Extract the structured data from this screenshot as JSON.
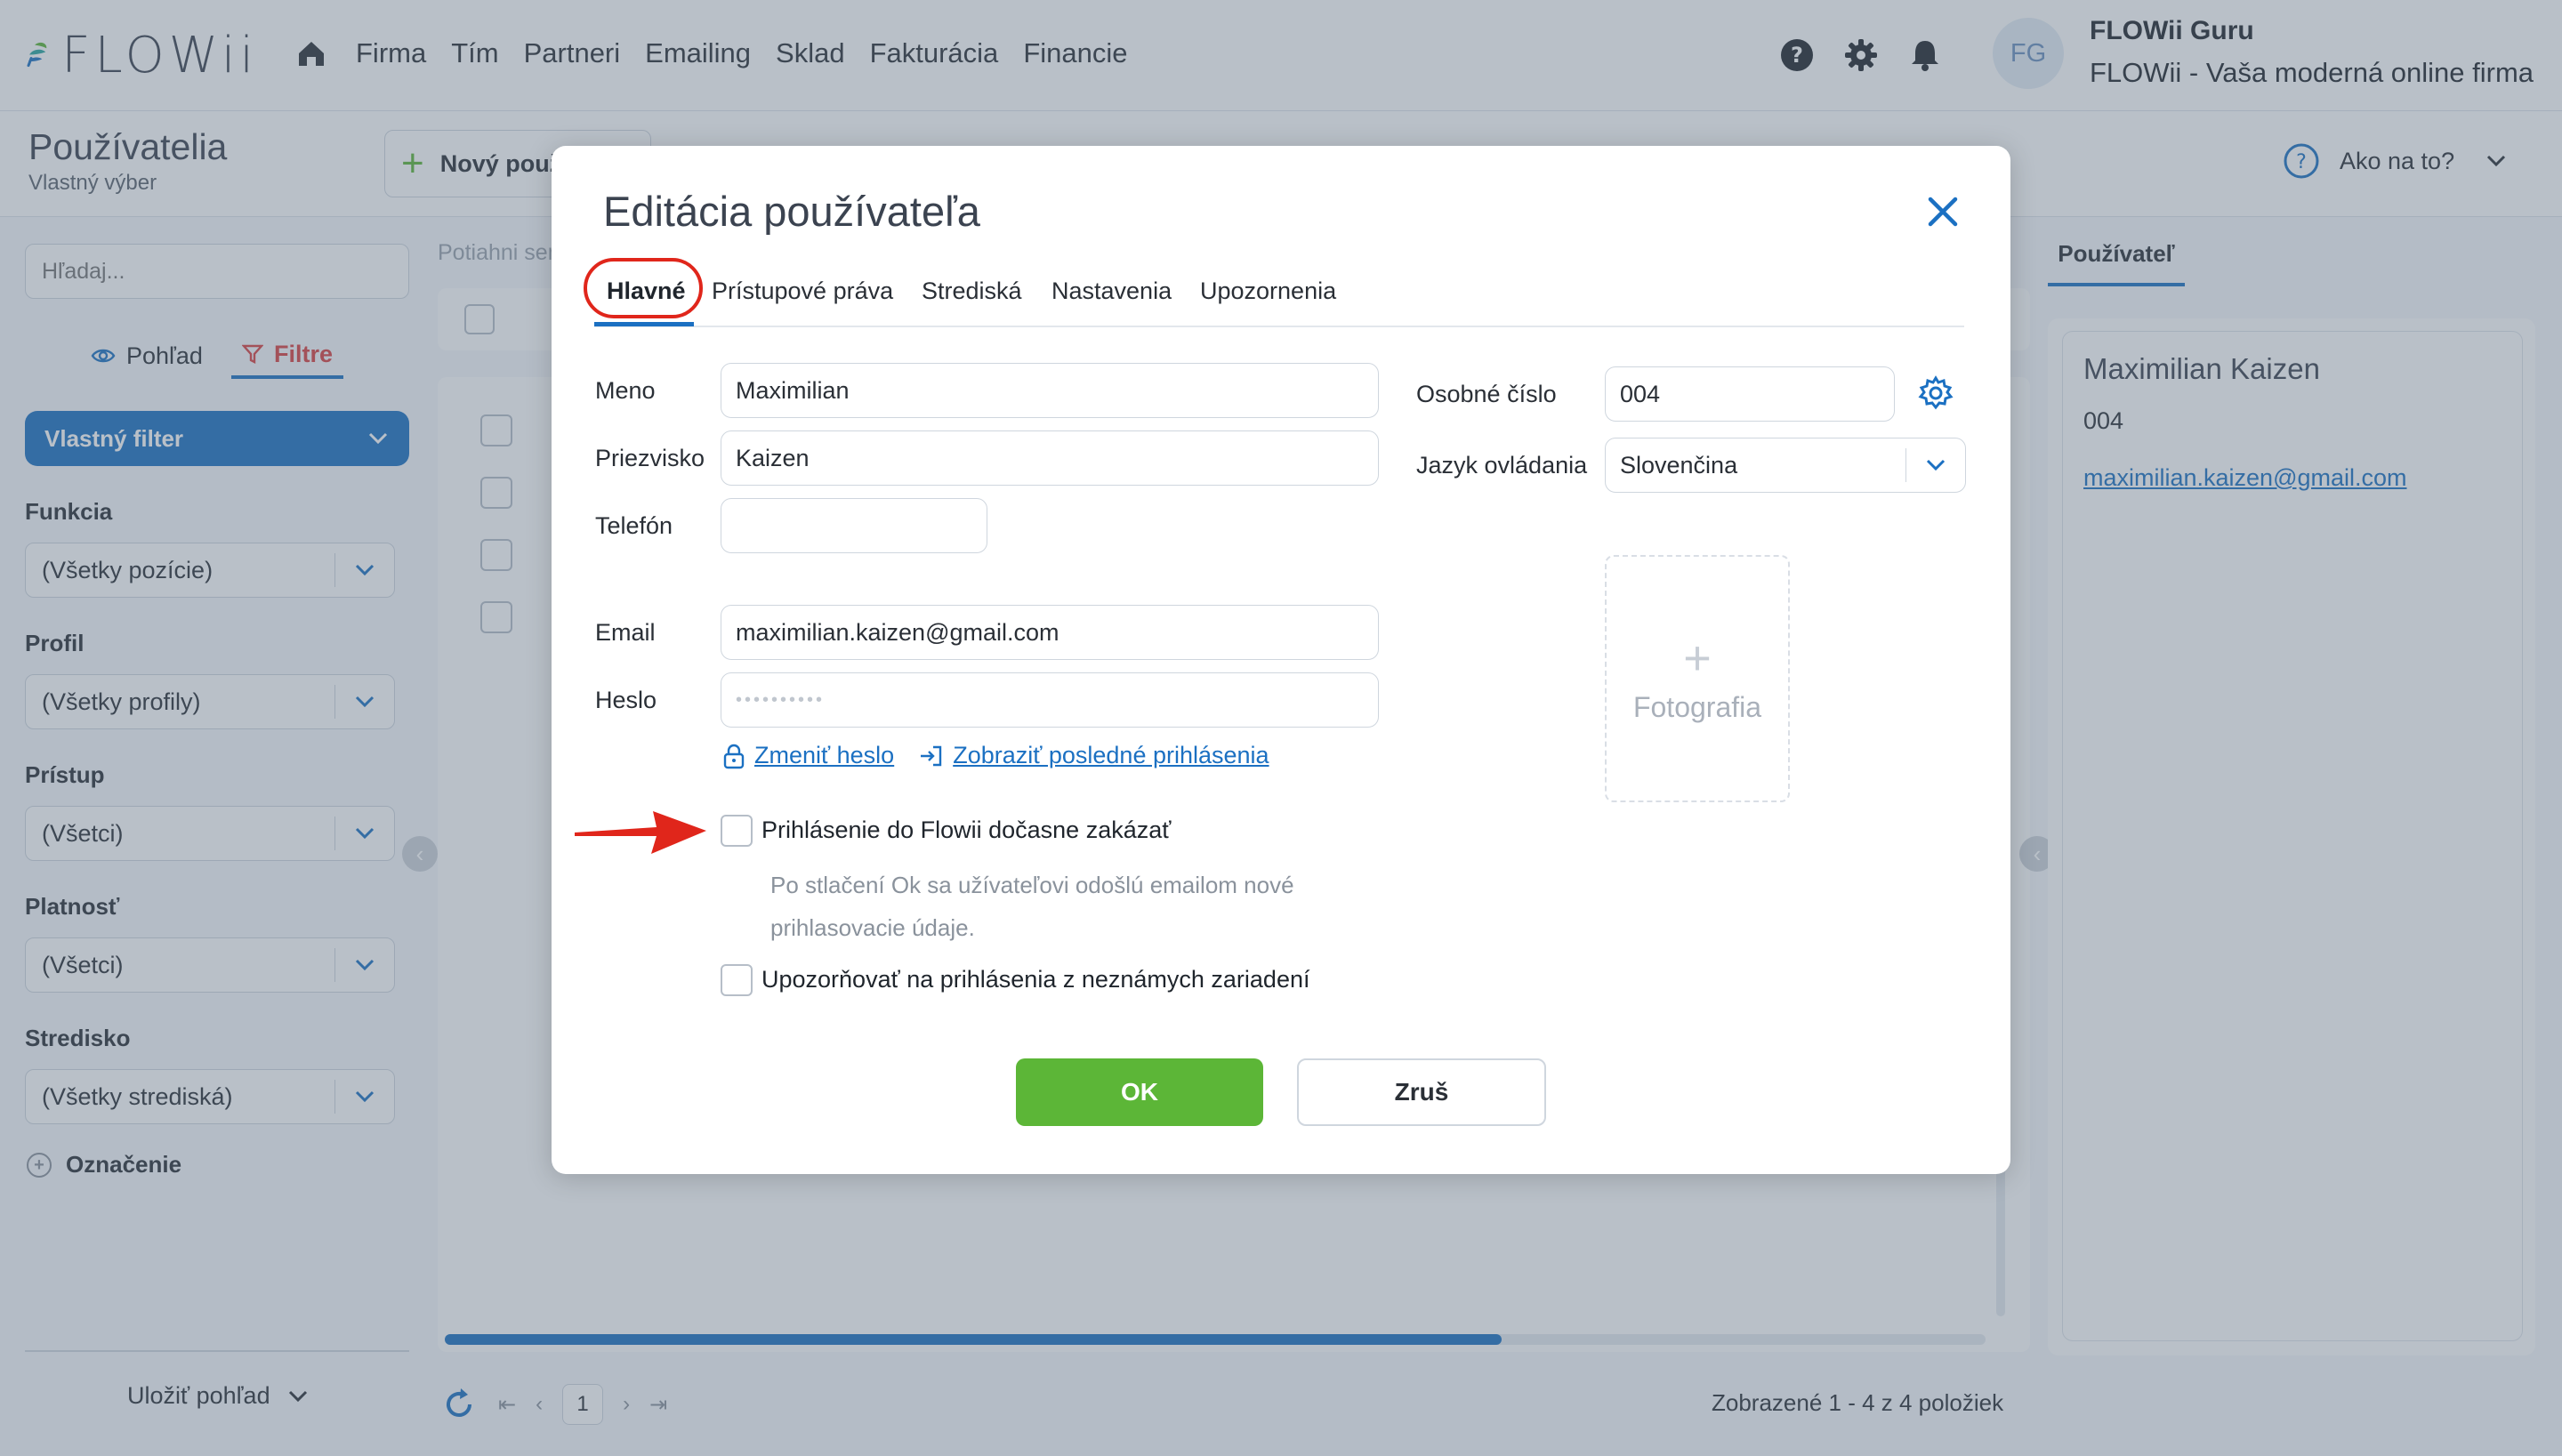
{
  "app": {
    "brand": "FLOWii",
    "nav": [
      "Firma",
      "Tím",
      "Partneri",
      "Emailing",
      "Sklad",
      "Fakturácia",
      "Financie"
    ],
    "user_initials": "FG",
    "user_name": "FLOWii Guru",
    "user_company": "FLOWii - Vaša moderná online firma"
  },
  "page": {
    "title": "Používatelia",
    "subtitle": "Vlastný výber",
    "new_button": "Nový používateľ",
    "help": "Ako na to?"
  },
  "left": {
    "search_placeholder": "Hľadaj...",
    "tab_view": "Pohľad",
    "tab_filters": "Filtre",
    "filter_header": "Vlastný filter",
    "filters": [
      {
        "label": "Funkcia",
        "value": "(Všetky pozície)"
      },
      {
        "label": "Profil",
        "value": "(Všetky profily)"
      },
      {
        "label": "Prístup",
        "value": "(Všetci)"
      },
      {
        "label": "Platnosť",
        "value": "(Všetci)"
      },
      {
        "label": "Stredisko",
        "value": "(Všetky strediská)"
      }
    ],
    "tag_label": "Označenie",
    "save_view": "Uložiť pohľad"
  },
  "table": {
    "drag_hint": "Potiahni sem",
    "page_current": "1",
    "summary": "Zobrazené 1 - 4 z 4 položiek",
    "scroll_fraction": 0.686
  },
  "detail": {
    "tab": "Používateľ",
    "name": "Maximilian Kaizen",
    "number": "004",
    "email": "maximilian.kaizen@gmail.com"
  },
  "modal": {
    "title": "Editácia používateľa",
    "tabs": [
      "Hlavné",
      "Prístupové práva",
      "Strediská",
      "Nastavenia",
      "Upozornenia"
    ],
    "active_tab": "Hlavné",
    "fields": {
      "first_name_label": "Meno",
      "first_name": "Maximilian",
      "last_name_label": "Priezvisko",
      "last_name": "Kaizen",
      "phone_label": "Telefón",
      "phone": "",
      "email_label": "Email",
      "email": "maximilian.kaizen@gmail.com",
      "password_label": "Heslo",
      "password_mask": "••••••••••",
      "personal_number_label": "Osobné číslo",
      "personal_number": "004",
      "language_label": "Jazyk ovládania",
      "language": "Slovenčina"
    },
    "change_password": "Zmeniť heslo",
    "show_logins": "Zobraziť posledné prihlásenia",
    "disable_login": "Prihlásenie do Flowii dočasne zakázať",
    "hint_line1": "Po stlačení Ok sa užívateľovi odošlú emailom nové",
    "hint_line2": "prihlasovacie údaje.",
    "notify_unknown": "Upozorňovať na prihlásenia z neznámych zariadení",
    "photo": "Fotografia",
    "ok": "OK",
    "cancel": "Zruš"
  },
  "colors": {
    "accent": "#1b70c2",
    "ok_green": "#5cb637",
    "annotation_red": "#e0261b",
    "filter_red": "#d94040"
  }
}
